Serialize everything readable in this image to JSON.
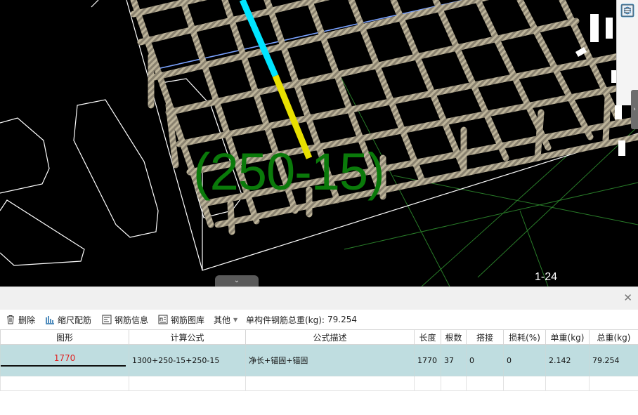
{
  "viewport": {
    "dimension_label": "(250-15)",
    "view_label": "1-24",
    "colors": {
      "background": "#000000",
      "dimension": "#0a7a0a",
      "highlight_top": "#00e5ff",
      "highlight_bottom": "#e8e000"
    }
  },
  "right_toolbar": {
    "icons": [
      "cube-view-icon",
      "fullscreen-icon",
      "3d-box-icon",
      "list-icon"
    ]
  },
  "toolbar": {
    "delete_label": "删除",
    "scale_rebar_label": "缩尺配筋",
    "rebar_info_label": "钢筋信息",
    "rebar_library_label": "钢筋图库",
    "other_label": "其他",
    "total_weight_label": "单构件钢筋总重(kg):",
    "total_weight_value": "79.254"
  },
  "grid": {
    "columns": [
      "图形",
      "计算公式",
      "公式描述",
      "长度",
      "根数",
      "搭接",
      "损耗(%)",
      "单重(kg)",
      "总重(kg)"
    ],
    "rows": [
      {
        "shape_value": "1770",
        "formula": "1300+250-15+250-15",
        "description": "净长+锚固+锚固",
        "length": "1770",
        "count": "37",
        "lap": "0",
        "loss": "0",
        "unit_weight": "2.142",
        "total_weight": "79.254"
      }
    ]
  }
}
